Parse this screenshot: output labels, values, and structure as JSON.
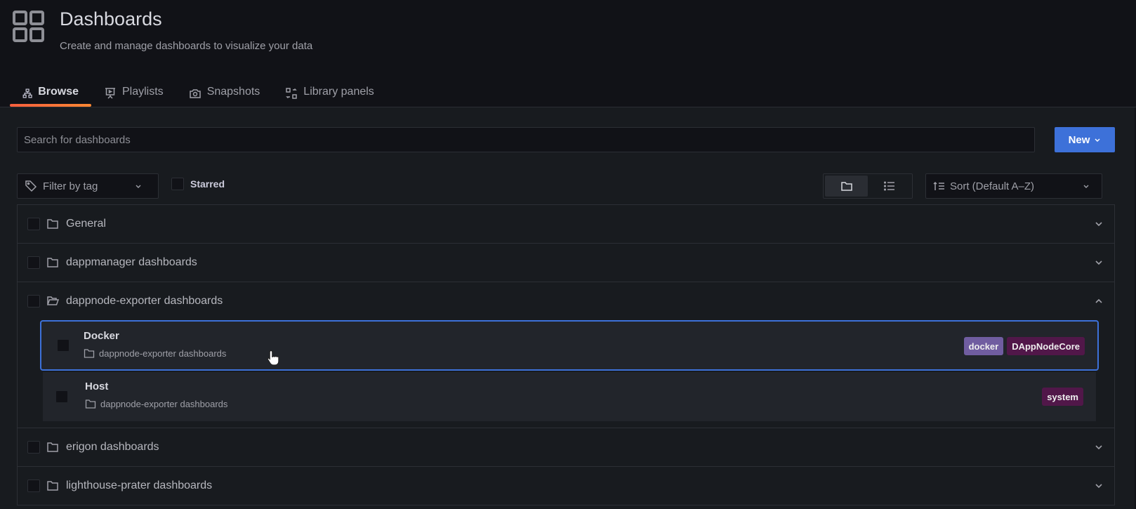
{
  "header": {
    "icon": "apps-grid-icon",
    "title": "Dashboards",
    "subtitle": "Create and manage dashboards to visualize your data"
  },
  "tabs": [
    {
      "label": "Browse",
      "icon": "sitemap-icon",
      "active": true
    },
    {
      "label": "Playlists",
      "icon": "presentation-play-icon",
      "active": false
    },
    {
      "label": "Snapshots",
      "icon": "camera-icon",
      "active": false
    },
    {
      "label": "Library panels",
      "icon": "library-panel-icon",
      "active": false
    }
  ],
  "toolbar": {
    "search_placeholder": "Search for dashboards",
    "search_value": "",
    "new_label": "New",
    "filter_tag_label": "Filter by tag",
    "starred_label": "Starred",
    "starred_checked": false,
    "view_mode": "folders",
    "sort_label": "Sort (Default A–Z)"
  },
  "folders": [
    {
      "name": "General",
      "expanded": false,
      "icon": "folder-icon"
    },
    {
      "name": "dappmanager dashboards",
      "expanded": false,
      "icon": "folder-icon"
    },
    {
      "name": "dappnode-exporter dashboards",
      "expanded": true,
      "icon": "folder-open-icon",
      "dashboards": [
        {
          "title": "Docker",
          "folder": "dappnode-exporter dashboards",
          "selected": true,
          "tags": [
            {
              "label": "docker",
              "color": "#705da0"
            },
            {
              "label": "DAppNodeCore",
              "color": "#511749"
            }
          ]
        },
        {
          "title": "Host",
          "folder": "dappnode-exporter dashboards",
          "selected": false,
          "tags": [
            {
              "label": "system",
              "color": "#511749"
            }
          ]
        }
      ]
    },
    {
      "name": "erigon dashboards",
      "expanded": false,
      "icon": "folder-icon"
    },
    {
      "name": "lighthouse-prater dashboards",
      "expanded": false,
      "icon": "folder-icon"
    }
  ],
  "colors": {
    "accent": "#3d71d9",
    "tab_underline": "#ff7833",
    "background": "#111217",
    "panel": "#181b1f"
  }
}
